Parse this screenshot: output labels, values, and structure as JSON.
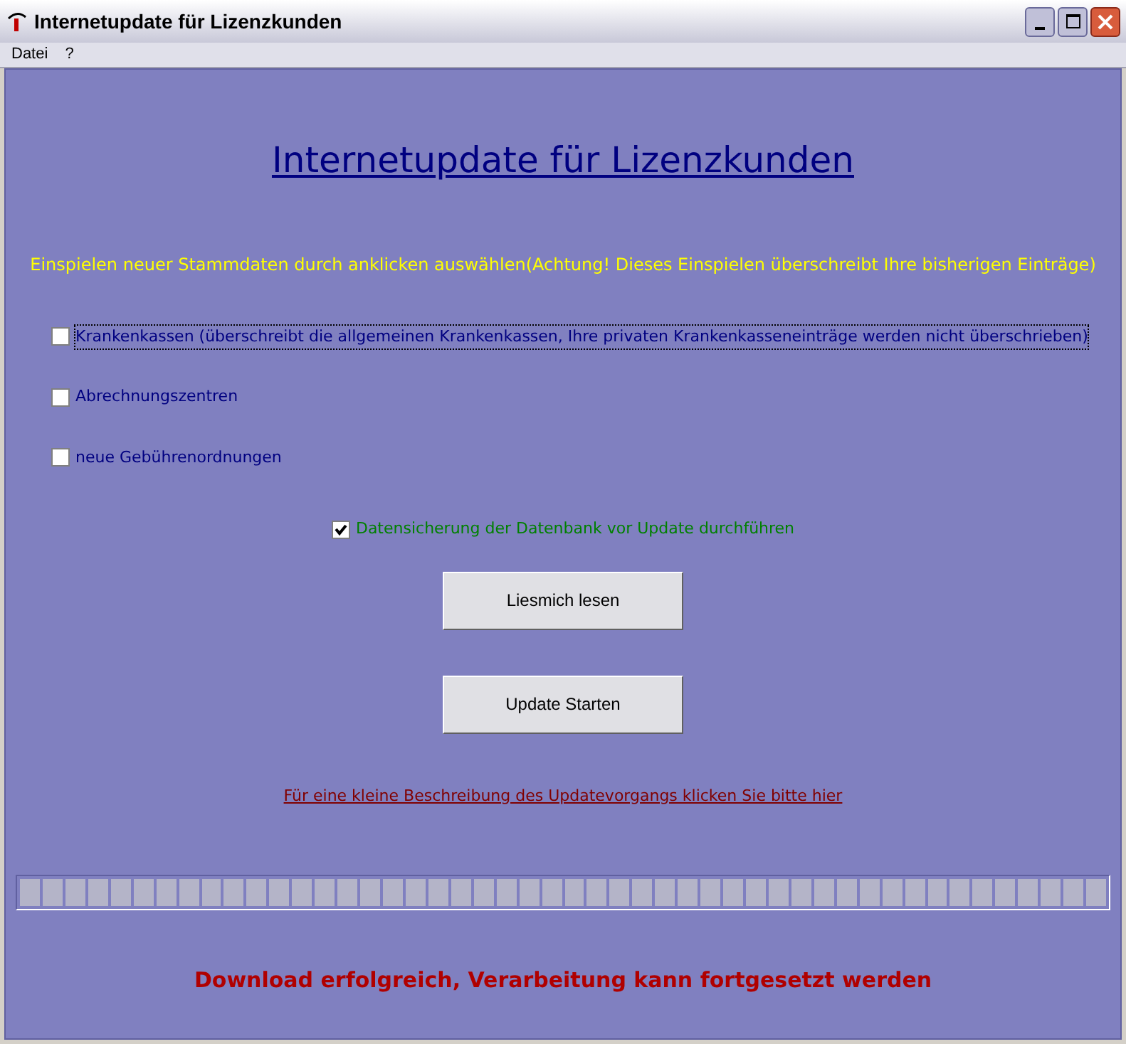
{
  "window": {
    "title": "Internetupdate für Lizenzkunden"
  },
  "menu": [
    "Datei",
    "?"
  ],
  "heading": "Internetupdate für Lizenzkunden",
  "instruction": "Einspielen neuer Stammdaten durch anklicken auswählen(Achtung! Dieses Einspielen überschreibt Ihre bisherigen Einträge)",
  "options": [
    {
      "label": "Krankenkassen (überschreibt die allgemeinen Krankenkassen, Ihre privaten Krankenkasseneinträge werden nicht überschrieben)",
      "checked": false,
      "focused": true
    },
    {
      "label": "Abrechnungszentren",
      "checked": false,
      "focused": false
    },
    {
      "label": "neue Gebührenordnungen",
      "checked": false,
      "focused": false
    }
  ],
  "backup": {
    "label": "Datensicherung der Datenbank vor Update durchführen",
    "checked": true
  },
  "buttons": [
    "Liesmich lesen",
    "Update Starten"
  ],
  "link": "Für eine kleine Beschreibung des Updatevorgangs klicken Sie bitte hier",
  "progress": {
    "level": 1
  },
  "status": "Download erfolgreich, Verarbeitung kann fortgesetzt werden"
}
